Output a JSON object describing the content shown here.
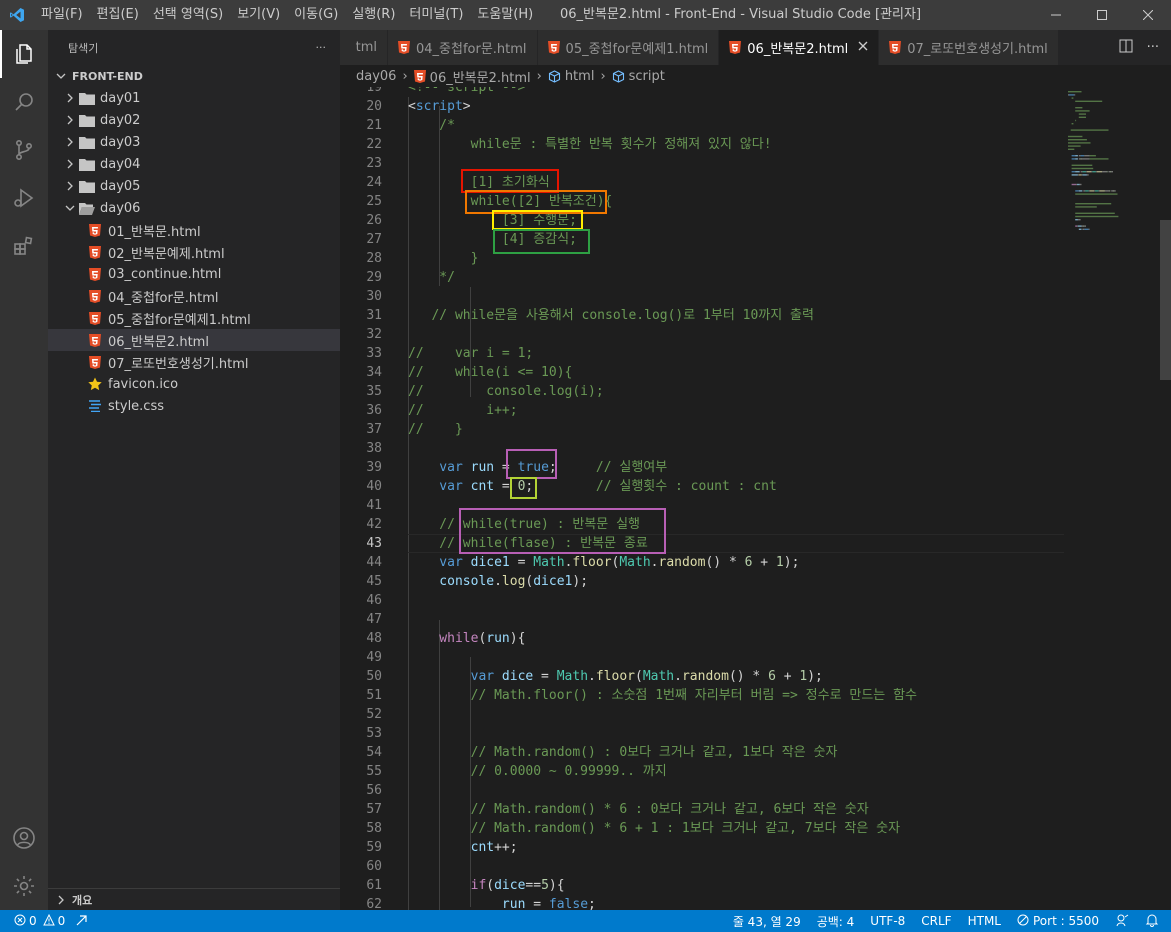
{
  "window": {
    "title": "06_반복문2.html - Front-End - Visual Studio Code [관리자]",
    "menu": [
      "파일(F)",
      "편집(E)",
      "선택 영역(S)",
      "보기(V)",
      "이동(G)",
      "실행(R)",
      "터미널(T)",
      "도움말(H)"
    ]
  },
  "sidebar": {
    "header": "탐색기",
    "more": "···",
    "section": "FRONT-END",
    "outline": "개요",
    "items": [
      {
        "label": "day01",
        "type": "folder",
        "depth": 0,
        "expanded": false,
        "selected": false
      },
      {
        "label": "day02",
        "type": "folder",
        "depth": 0,
        "expanded": false,
        "selected": false
      },
      {
        "label": "day03",
        "type": "folder",
        "depth": 0,
        "expanded": false,
        "selected": false
      },
      {
        "label": "day04",
        "type": "folder",
        "depth": 0,
        "expanded": false,
        "selected": false
      },
      {
        "label": "day05",
        "type": "folder",
        "depth": 0,
        "expanded": false,
        "selected": false
      },
      {
        "label": "day06",
        "type": "folder",
        "depth": 0,
        "expanded": true,
        "selected": false
      },
      {
        "label": "01_반복문.html",
        "type": "html",
        "depth": 1,
        "selected": false
      },
      {
        "label": "02_반복문예제.html",
        "type": "html",
        "depth": 1,
        "selected": false
      },
      {
        "label": "03_continue.html",
        "type": "html",
        "depth": 1,
        "selected": false
      },
      {
        "label": "04_중첩for문.html",
        "type": "html",
        "depth": 1,
        "selected": false
      },
      {
        "label": "05_중첩for문예제1.html",
        "type": "html",
        "depth": 1,
        "selected": false
      },
      {
        "label": "06_반복문2.html",
        "type": "html",
        "depth": 1,
        "selected": true
      },
      {
        "label": "07_로또번호생성기.html",
        "type": "html",
        "depth": 1,
        "selected": false
      },
      {
        "label": "favicon.ico",
        "type": "star",
        "depth": 0,
        "selected": false
      },
      {
        "label": "style.css",
        "type": "css",
        "depth": 0,
        "selected": false
      }
    ]
  },
  "tabs": [
    {
      "label": "tml",
      "icon": false,
      "active": false
    },
    {
      "label": "04_중첩for문.html",
      "icon": true,
      "active": false
    },
    {
      "label": "05_중첩for문예제1.html",
      "icon": true,
      "active": false
    },
    {
      "label": "06_반복문2.html",
      "icon": true,
      "active": true
    },
    {
      "label": "07_로또번호생성기.html",
      "icon": true,
      "active": false
    }
  ],
  "breadcrumb": [
    "day06",
    "06_반복문2.html",
    "html",
    "script"
  ],
  "editor": {
    "current_line": 43,
    "lines": [
      {
        "n": 19,
        "t": [
          [
            "cmt",
            "<!-- script -->"
          ]
        ]
      },
      {
        "n": 20,
        "t": [
          [
            "",
            "<"
          ],
          [
            "tag",
            "script"
          ],
          [
            "",
            ">"
          ]
        ]
      },
      {
        "n": 21,
        "t": [
          [
            "cmt",
            "    /*"
          ]
        ]
      },
      {
        "n": 22,
        "t": [
          [
            "cmt",
            "        while문 : 특별한 반복 횟수가 정해져 있지 않다!"
          ]
        ]
      },
      {
        "n": 23,
        "t": []
      },
      {
        "n": 24,
        "t": [
          [
            "cmt",
            "        [1] 초기화식"
          ]
        ]
      },
      {
        "n": 25,
        "t": [
          [
            "cmt",
            "        while([2] 반복조건){"
          ]
        ]
      },
      {
        "n": 26,
        "t": [
          [
            "cmt",
            "            [3] 수행문;"
          ]
        ]
      },
      {
        "n": 27,
        "t": [
          [
            "cmt",
            "            [4] 증감식;"
          ]
        ]
      },
      {
        "n": 28,
        "t": [
          [
            "cmt",
            "        }"
          ]
        ]
      },
      {
        "n": 29,
        "t": [
          [
            "cmt",
            "    */"
          ]
        ]
      },
      {
        "n": 30,
        "t": []
      },
      {
        "n": 31,
        "t": [
          [
            "cmt",
            "   // while문을 사용해서 console.log()로 1부터 10까지 출력"
          ]
        ]
      },
      {
        "n": 32,
        "t": []
      },
      {
        "n": 33,
        "t": [
          [
            "cmt",
            "//    var i = 1;"
          ]
        ]
      },
      {
        "n": 34,
        "t": [
          [
            "cmt",
            "//    while(i <= 10){"
          ]
        ]
      },
      {
        "n": 35,
        "t": [
          [
            "cmt",
            "//        console.log(i);"
          ]
        ]
      },
      {
        "n": 36,
        "t": [
          [
            "cmt",
            "//        i++;"
          ]
        ]
      },
      {
        "n": 37,
        "t": [
          [
            "cmt",
            "//    }"
          ]
        ]
      },
      {
        "n": 38,
        "t": []
      },
      {
        "n": 39,
        "t": [
          [
            "kw",
            "    var "
          ],
          [
            "vr",
            "run"
          ],
          [
            "",
            " = "
          ],
          [
            "kw",
            "true"
          ],
          [
            "",
            ";     "
          ],
          [
            "cmt",
            "// 실행여부"
          ]
        ]
      },
      {
        "n": 40,
        "t": [
          [
            "kw",
            "    var "
          ],
          [
            "vr",
            "cnt"
          ],
          [
            "",
            " = "
          ],
          [
            "num",
            "0"
          ],
          [
            "",
            ";        "
          ],
          [
            "cmt",
            "// 실행횟수 : count : cnt"
          ]
        ]
      },
      {
        "n": 41,
        "t": []
      },
      {
        "n": 42,
        "t": [
          [
            "cmt",
            "    // while(true) : 반복문 실행"
          ]
        ]
      },
      {
        "n": 43,
        "t": [
          [
            "cmt",
            "    // while(flase) : 반복문 종료"
          ]
        ]
      },
      {
        "n": 44,
        "t": [
          [
            "kw",
            "    var "
          ],
          [
            "vr",
            "dice1"
          ],
          [
            "",
            " = "
          ],
          [
            "cls",
            "Math"
          ],
          [
            "",
            "."
          ],
          [
            "fn",
            "floor"
          ],
          [
            "",
            "("
          ],
          [
            "cls",
            "Math"
          ],
          [
            "",
            "."
          ],
          [
            "fn",
            "random"
          ],
          [
            "",
            "() * "
          ],
          [
            "num",
            "6"
          ],
          [
            "",
            " + "
          ],
          [
            "num",
            "1"
          ],
          [
            "",
            ");"
          ]
        ]
      },
      {
        "n": 45,
        "t": [
          [
            "vr",
            "    console"
          ],
          [
            "",
            "."
          ],
          [
            "fn",
            "log"
          ],
          [
            "",
            "("
          ],
          [
            "vr",
            "dice1"
          ],
          [
            "",
            ");"
          ]
        ]
      },
      {
        "n": 46,
        "t": []
      },
      {
        "n": 47,
        "t": []
      },
      {
        "n": 48,
        "t": [
          [
            "ctl",
            "    while"
          ],
          [
            "",
            "("
          ],
          [
            "vr",
            "run"
          ],
          [
            "",
            "){"
          ]
        ]
      },
      {
        "n": 49,
        "t": []
      },
      {
        "n": 50,
        "t": [
          [
            "kw",
            "        var "
          ],
          [
            "vr",
            "dice"
          ],
          [
            "",
            " = "
          ],
          [
            "cls",
            "Math"
          ],
          [
            "",
            "."
          ],
          [
            "fn",
            "floor"
          ],
          [
            "",
            "("
          ],
          [
            "cls",
            "Math"
          ],
          [
            "",
            "."
          ],
          [
            "fn",
            "random"
          ],
          [
            "",
            "() * "
          ],
          [
            "num",
            "6"
          ],
          [
            "",
            " + "
          ],
          [
            "num",
            "1"
          ],
          [
            "",
            ");"
          ]
        ]
      },
      {
        "n": 51,
        "t": [
          [
            "cmt",
            "        // Math.floor() : 소숫점 1번째 자리부터 버림 => 정수로 만드는 함수"
          ]
        ]
      },
      {
        "n": 52,
        "t": []
      },
      {
        "n": 53,
        "t": []
      },
      {
        "n": 54,
        "t": [
          [
            "cmt",
            "        // Math.random() : 0보다 크거나 같고, 1보다 작은 숫자"
          ]
        ]
      },
      {
        "n": 55,
        "t": [
          [
            "cmt",
            "        // 0.0000 ~ 0.99999.. 까지"
          ]
        ]
      },
      {
        "n": 56,
        "t": []
      },
      {
        "n": 57,
        "t": [
          [
            "cmt",
            "        // Math.random() * 6 : 0보다 크거나 같고, 6보다 작은 숫자"
          ]
        ]
      },
      {
        "n": 58,
        "t": [
          [
            "cmt",
            "        // Math.random() * 6 + 1 : 1보다 크거나 같고, 7보다 작은 숫자"
          ]
        ]
      },
      {
        "n": 59,
        "t": [
          [
            "vr",
            "        cnt"
          ],
          [
            "",
            "++;"
          ]
        ]
      },
      {
        "n": 60,
        "t": []
      },
      {
        "n": 61,
        "t": [
          [
            "ctl",
            "        if"
          ],
          [
            "",
            "("
          ],
          [
            "vr",
            "dice"
          ],
          [
            "",
            "=="
          ],
          [
            "num",
            "5"
          ],
          [
            "",
            "){"
          ]
        ]
      },
      {
        "n": 62,
        "t": [
          [
            "vr",
            "            run"
          ],
          [
            "",
            " = "
          ],
          [
            "kw",
            "false"
          ],
          [
            "",
            ";"
          ]
        ]
      }
    ]
  },
  "statusbar": {
    "errors": "0",
    "warnings": "0",
    "position": "줄 43, 열 29",
    "spaces": "공백: 4",
    "encoding": "UTF-8",
    "eol": "CRLF",
    "language": "HTML",
    "port": "Port : 5500"
  },
  "colors": {
    "accent": "#007acc",
    "highlight_red": "#e51400",
    "highlight_orange": "#f07800",
    "highlight_yellow": "#ffee00",
    "highlight_green": "#2ea043",
    "highlight_purple": "#b85fb5",
    "highlight_lime": "#b3d335"
  }
}
